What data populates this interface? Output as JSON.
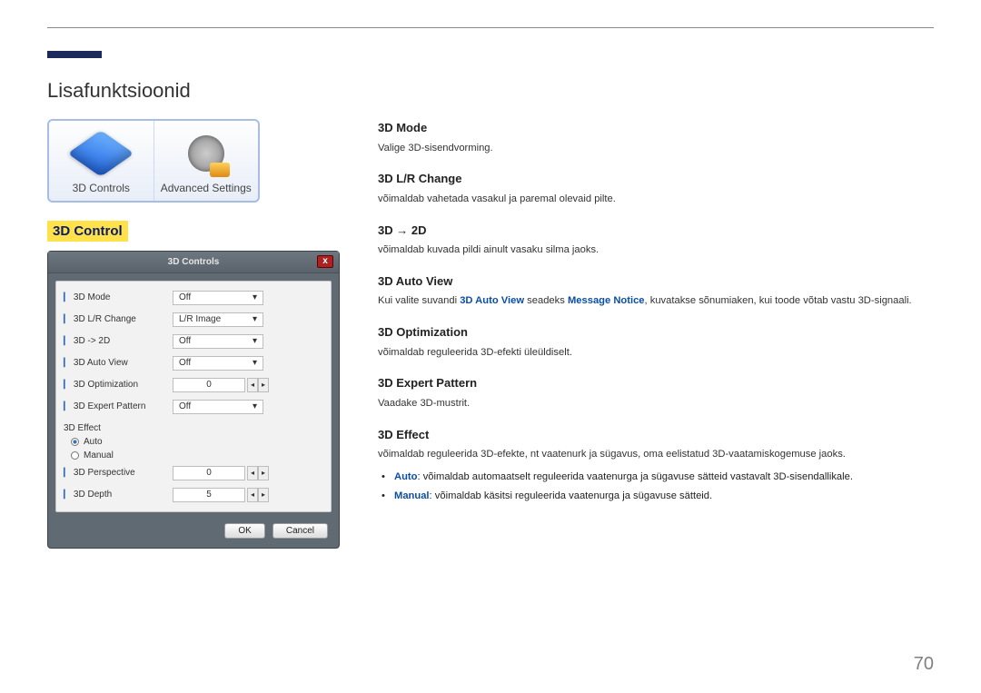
{
  "page": {
    "title": "Lisafunktsioonid",
    "number": "70"
  },
  "tiles": {
    "a": "3D Controls",
    "b": "Advanced Settings"
  },
  "section_heading": "3D Control",
  "window": {
    "title": "3D Controls",
    "close": "x",
    "rows": [
      {
        "label": "3D Mode",
        "value": "Off"
      },
      {
        "label": "3D L/R Change",
        "value": "L/R Image"
      },
      {
        "label": "3D -> 2D",
        "value": "Off"
      },
      {
        "label": "3D Auto View",
        "value": "Off"
      },
      {
        "label": "3D Optimization",
        "value": "0"
      },
      {
        "label": "3D Expert Pattern",
        "value": "Off"
      }
    ],
    "effect_group": "3D Effect",
    "radio_auto": "Auto",
    "radio_manual": "Manual",
    "perspective": {
      "label": "3D Perspective",
      "value": "0"
    },
    "depth": {
      "label": "3D Depth",
      "value": "5"
    },
    "ok": "OK",
    "cancel": "Cancel"
  },
  "defs": {
    "mode": {
      "h": "3D Mode",
      "p": "Valige 3D-sisendvorming."
    },
    "lr": {
      "h": "3D L/R Change",
      "p": "võimaldab vahetada vasakul ja paremal olevaid pilte."
    },
    "to2d": {
      "h": "3D → 2D",
      "p": "võimaldab kuvada pildi ainult vasaku silma jaoks."
    },
    "auto": {
      "h": "3D Auto View",
      "pre": "Kui valite suvandi ",
      "b1": "3D Auto View",
      "mid": " seadeks ",
      "b2": "Message Notice",
      "post": ", kuvatakse sõnumiaken, kui toode võtab vastu 3D-signaali."
    },
    "opt": {
      "h": "3D Optimization",
      "p": "võimaldab reguleerida 3D-efekti üleüldiselt."
    },
    "exp": {
      "h": "3D Expert Pattern",
      "p": "Vaadake 3D-mustrit."
    },
    "effect": {
      "h": "3D Effect",
      "p": "võimaldab reguleerida 3D-efekte, nt vaatenurk ja sügavus, oma eelistatud 3D-vaatamiskogemuse jaoks.",
      "li1a": "Auto",
      "li1b": ": võimaldab automaatselt reguleerida vaatenurga ja sügavuse sätteid vastavalt 3D-sisendallikale.",
      "li2a": "Manual",
      "li2b": ": võimaldab käsitsi reguleerida vaatenurga ja sügavuse sätteid."
    }
  }
}
